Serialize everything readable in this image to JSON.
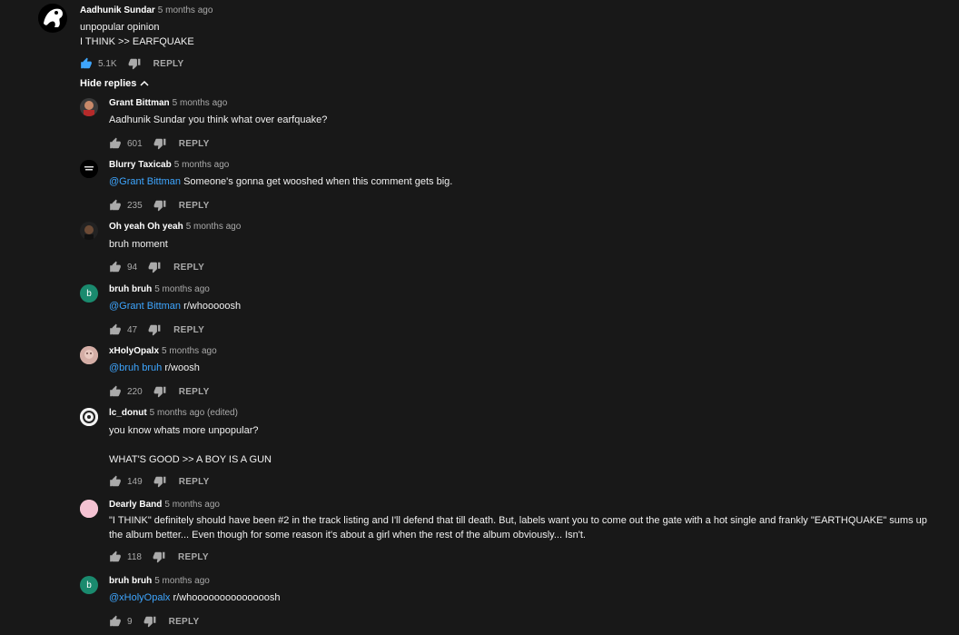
{
  "top_comment": {
    "author": "Aadhunik Sundar",
    "time": "5 months ago",
    "lines": [
      "unpopular opinion",
      "I THINK >> EARFQUAKE"
    ],
    "likes": "5.1K",
    "reply_label": "REPLY"
  },
  "hide_replies_label": "Hide replies",
  "replies": [
    {
      "author": "Grant Bittman",
      "time": "5 months ago",
      "mention": "",
      "text": "Aadhunik Sundar you think what over earfquake?",
      "likes": "601",
      "reply_label": "REPLY"
    },
    {
      "author": "Blurry Taxicab",
      "time": "5 months ago",
      "mention": "@Grant Bittman",
      "text": " Someone's gonna get wooshed when this comment gets big.",
      "likes": "235",
      "reply_label": "REPLY"
    },
    {
      "author": "Oh yeah Oh yeah",
      "time": "5 months ago",
      "mention": "",
      "text": "bruh moment",
      "likes": "94",
      "reply_label": "REPLY"
    },
    {
      "author": "bruh bruh",
      "time": "5 months ago",
      "mention": "@Grant Bittman",
      "text": " r/whooooosh",
      "likes": "47",
      "reply_label": "REPLY",
      "avatar_letter": "b"
    },
    {
      "author": "xHolyOpalx",
      "time": "5 months ago",
      "mention": "@bruh bruh",
      "text": " r/woosh",
      "likes": "220",
      "reply_label": "REPLY"
    },
    {
      "author": "lc_donut",
      "time": "5 months ago (edited)",
      "mention": "",
      "text": "you know whats more unpopular?",
      "text2": "WHAT'S GOOD >> A BOY IS A GUN",
      "likes": "149",
      "reply_label": "REPLY"
    },
    {
      "author": "Dearly Band",
      "time": "5 months ago",
      "mention": "",
      "text": "\"I THINK\" definitely should have been #2 in the track listing and I'll defend that till death. But, labels want you to come out the gate with a hot single and frankly \"EARTHQUAKE\" sums up the album better... Even though for some reason it's about a girl when the rest of the album obviously... Isn't.",
      "likes": "118",
      "reply_label": "REPLY"
    },
    {
      "author": "bruh bruh",
      "time": "5 months ago",
      "mention": "@xHolyOpalx",
      "text": " r/whoooooooooooooosh",
      "likes": "9",
      "reply_label": "REPLY",
      "avatar_letter": "b"
    }
  ],
  "colors": {
    "background": "#181818",
    "mention": "#3ea6ff",
    "liked": "#3ea6ff",
    "avatar_green": "#1a8a6e"
  }
}
